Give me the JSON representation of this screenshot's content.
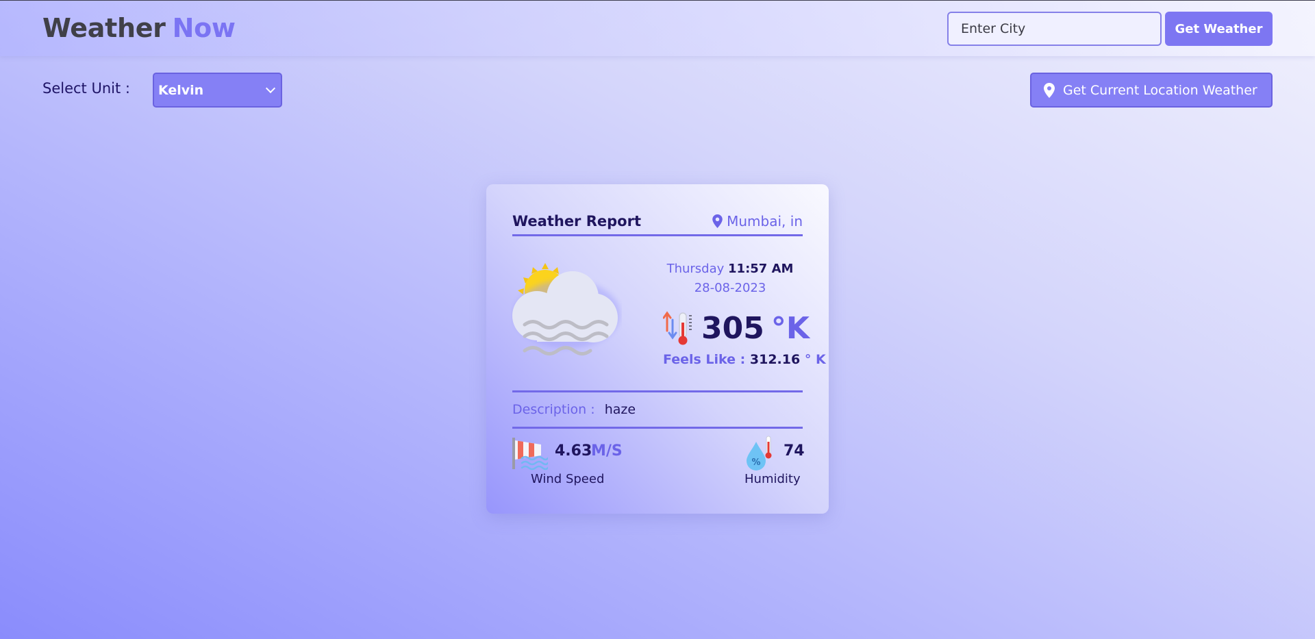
{
  "header": {
    "brand_part1": "Weather",
    "brand_part2": "Now",
    "search_placeholder": "Enter City",
    "search_button": "Get Weather"
  },
  "controls": {
    "unit_label": "Select Unit :",
    "unit_selected": "Kelvin",
    "location_button": "Get Current Location Weather"
  },
  "report": {
    "title": "Weather Report",
    "location": "Mumbai, in",
    "day": "Thursday",
    "time": "11:57 AM",
    "date": "28-08-2023",
    "temperature": "305",
    "temperature_unit": "°K",
    "feels_like_label": "Feels Like :",
    "feels_like_value": "312.16",
    "feels_like_unit": "° K",
    "description_label": "Description :",
    "description_value": "haze",
    "wind_speed_value": "4.63",
    "wind_speed_unit": "M/S",
    "wind_speed_label": "Wind Speed",
    "humidity_value": "74",
    "humidity_label": "Humidity"
  },
  "icons": {
    "weather": "sun-cloud-haze-icon",
    "location_pin": "location-pin-icon",
    "thermometer": "thermometer-icon",
    "wind": "windsock-icon",
    "humidity": "humidity-drop-icon"
  },
  "colors": {
    "accent": "#7d76f2",
    "accent_dark": "#6b63e8",
    "text_dark": "#1f155e"
  }
}
